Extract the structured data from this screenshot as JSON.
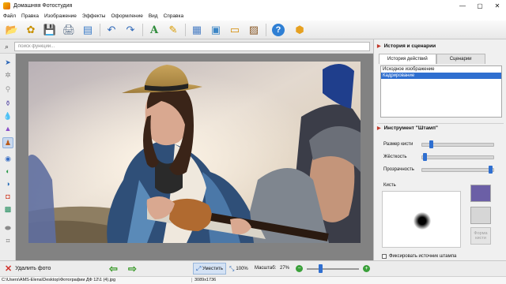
{
  "window": {
    "title": "Домашняя Фотостудия",
    "controls": [
      "—",
      "▢",
      "✕"
    ]
  },
  "menu": [
    "Файл",
    "Правка",
    "Изображение",
    "Эффекты",
    "Оформление",
    "Вид",
    "Справка"
  ],
  "search": {
    "placeholder": "поиск функций..."
  },
  "right_panel": {
    "history_header": "История и сценарии",
    "tabs": [
      "История действий",
      "Сценарии"
    ],
    "history_items": [
      "Исходное изображение",
      "Кадрирование"
    ],
    "tool_header": "Инструмент \"Штамп\"",
    "sliders": [
      {
        "label": "Размер кисти",
        "value": 0.12
      },
      {
        "label": "Жёсткость",
        "value": 0.02
      },
      {
        "label": "Прозрачность",
        "value": 0.98
      }
    ],
    "brush_label": "Кисть",
    "swatch_colors": {
      "primary": "#6b5fa6",
      "secondary": "#d6d6d6"
    },
    "shape_button": "Форма кисти",
    "fix_source_label": "Фиксировать источник штампа"
  },
  "bottom": {
    "delete_label": "Удалить фото",
    "fit_label": "Уместить",
    "zoom100_label": "100%",
    "scale_label": "Масштаб:",
    "scale_value": "27%"
  },
  "status": {
    "path": "C:\\Users\\AMS-Elena\\Desktop\\Фотографии ДФ 12\\1 (4).jpg",
    "dimensions": "3089x1736"
  },
  "colors": {
    "accent": "#2f6fd0",
    "canvas_bg": "#828282"
  }
}
